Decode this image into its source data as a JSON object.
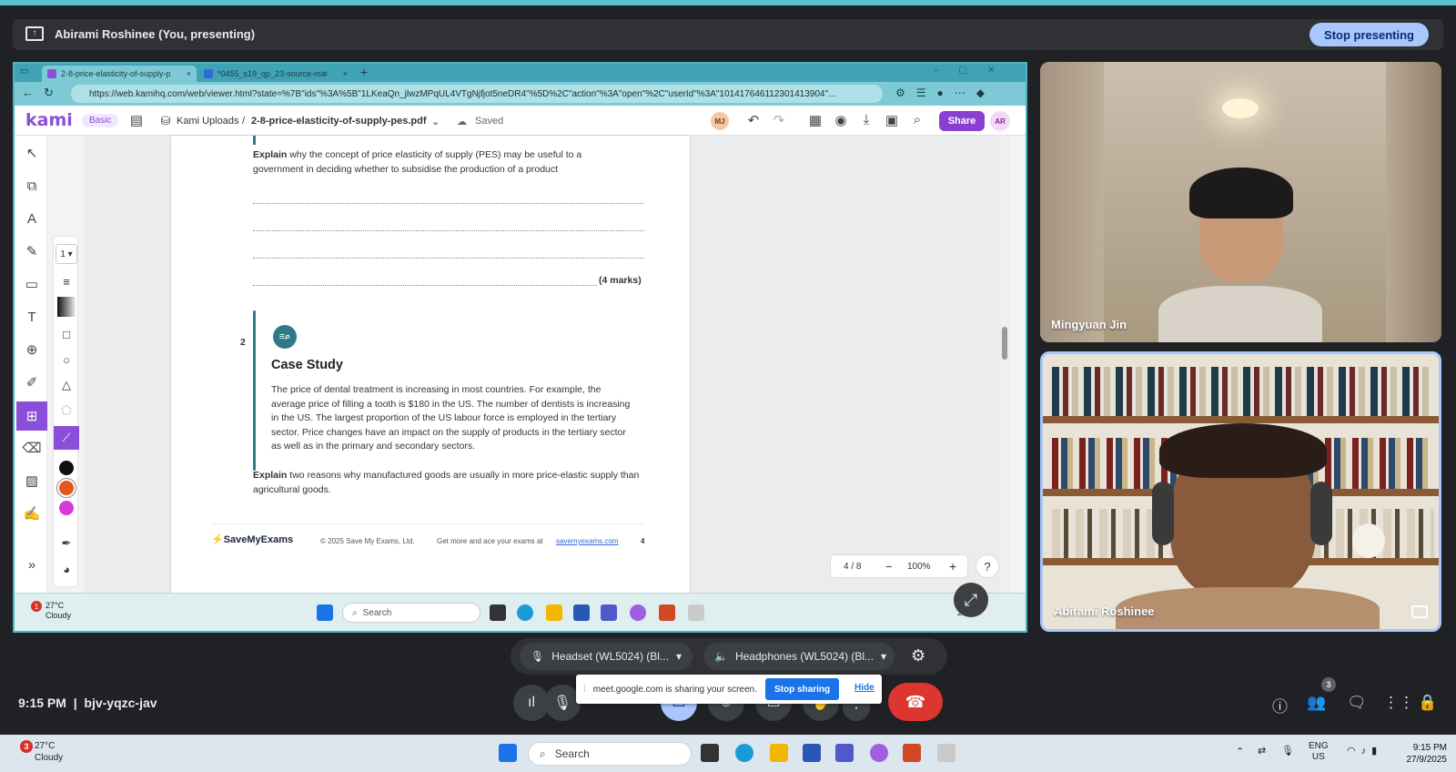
{
  "meet": {
    "presenting_label": "Abirami Roshinee (You, presenting)",
    "stop_presenting": "Stop presenting",
    "time": "9:15 PM",
    "separator": "|",
    "meeting_code": "bjv-yqzc-jav",
    "people_count": "3",
    "mic_device": "Headset (WL5024) (Bl...",
    "speaker_device": "Headphones (WL5024) (Bl...",
    "share_banner_text": "meet.google.com is sharing your screen.",
    "stop_sharing": "Stop sharing",
    "hide": "Hide",
    "participants": [
      {
        "name": "Mingyuan Jin"
      },
      {
        "name": "Abirami Roshinee"
      }
    ],
    "colors": {
      "stop_presenting_bg": "#a8c7fa",
      "end_call": "#dc362e",
      "tile_border": "#a8c7fa"
    }
  },
  "browser": {
    "tabs": [
      {
        "label": "2-8-price-elasticity-of-supply-pes",
        "icon": "kami-favicon"
      },
      {
        "label": "*0455_s19_qp_23-source-material",
        "icon": "doc-favicon"
      }
    ],
    "url": "https://web.kamihq.com/web/viewer.html?state=%7B\"ids\"%3A%5B\"1LKeaQn_jlwzMPqUL4VTgNjfjot5neDR4\"%5D%2C\"action\"%3A\"open\"%2C\"userId\"%3A\"101417646112301413904\"..."
  },
  "kami": {
    "logo": "kami",
    "plan_badge": "Basic",
    "breadcrumb_root": "Kami Uploads",
    "breadcrumb_sep": "/",
    "file_name": "2-8-price-elasticity-of-supply-pes.pdf",
    "saved": "Saved",
    "user_initials_mj": "MJ",
    "share": "Share",
    "user_initials_ar": "AR",
    "stroke_size": "1",
    "page_indicator": "4 / 8",
    "zoom": "100%",
    "minus": "−",
    "plus": "+",
    "help": "?",
    "swatches": [
      "#111111",
      "#e4571b",
      "#d63ad9"
    ]
  },
  "document": {
    "q1_bold": "Explain",
    "q1_text": " why the concept of price elasticity of supply (PES) may be useful to a government in deciding whether to subsidise the production of a product",
    "q1_marks": "(4 marks)",
    "q2_number": "2",
    "case_study_title": "Case Study",
    "case_study_text": "The price of dental treatment is increasing in most countries. For example, the average price of filling a tooth is $180 in the US. The number of dentists is increasing in the US. The largest proportion of the US labour force is employed in the tertiary sector. Price changes have an impact on the supply of products in the tertiary sector as well as in the primary and secondary sectors.",
    "q2_bold": "Explain",
    "q2_text": " two reasons why manufactured goods are usually in more price-elastic supply than agricultural goods.",
    "footer_brand": "SaveMyExams",
    "footer_copyright": "© 2025 Save My Exams, Ltd.",
    "footer_cta": "Get more and ace your exams at",
    "footer_link": "savemyexams.com",
    "footer_page": "4"
  },
  "shared_taskbar": {
    "temp": "27°C",
    "condition": "Cloudy",
    "badge": "1",
    "search": "Search",
    "clock_partial": "27/9"
  },
  "windows_taskbar": {
    "temp": "27°C",
    "condition": "Cloudy",
    "badge": "3",
    "search": "Search",
    "lang": "ENG",
    "region": "US",
    "time": "9:15 PM",
    "date": "27/9/2025"
  }
}
